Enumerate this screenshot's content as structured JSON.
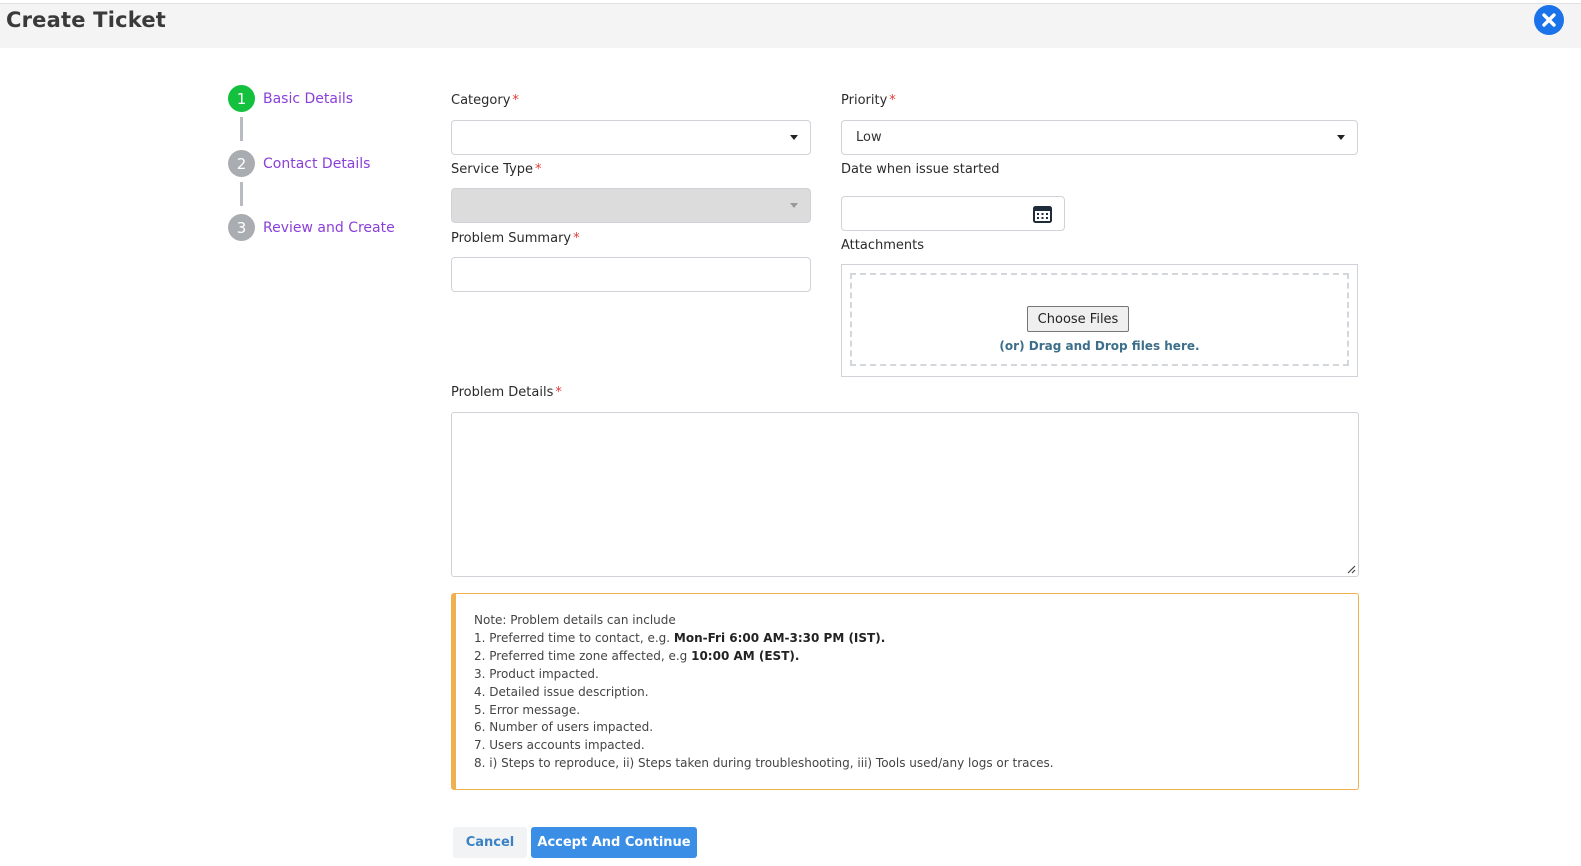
{
  "header": {
    "title": "Create Ticket"
  },
  "steps": [
    {
      "number": "1",
      "label": "Basic Details",
      "state": "active"
    },
    {
      "number": "2",
      "label": "Contact Details",
      "state": "pending"
    },
    {
      "number": "3",
      "label": "Review and Create",
      "state": "pending"
    }
  ],
  "form": {
    "category": {
      "label": "Category",
      "value": ""
    },
    "priority": {
      "label": "Priority",
      "value": "Low"
    },
    "service_type": {
      "label": "Service Type",
      "value": ""
    },
    "date_started": {
      "label": "Date when issue started",
      "value": ""
    },
    "problem_summary": {
      "label": "Problem Summary",
      "value": ""
    },
    "attachments": {
      "label": "Attachments",
      "choose_label": "Choose Files",
      "drop_prefix": "(or)",
      "drop_text": "Drag and Drop files here."
    },
    "problem_details": {
      "label": "Problem Details",
      "value": ""
    },
    "required_marker": "*"
  },
  "note": {
    "intro": "Note: Problem details can include",
    "items": [
      {
        "text": "1. Preferred time to contact, e.g. ",
        "bold": "Mon-Fri 6:00 AM-3:30 PM (IST)."
      },
      {
        "text": "2. Preferred time zone affected, e.g ",
        "bold": "10:00 AM (EST)."
      },
      {
        "text": "3. Product impacted.",
        "bold": ""
      },
      {
        "text": "4. Detailed issue description.",
        "bold": ""
      },
      {
        "text": "5. Error message.",
        "bold": ""
      },
      {
        "text": "6. Number of users impacted.",
        "bold": ""
      },
      {
        "text": "7. Users accounts impacted.",
        "bold": ""
      },
      {
        "text": "8. i) Steps to reproduce, ii) Steps taken during troubleshooting, iii) Tools used/any logs or traces.",
        "bold": ""
      }
    ]
  },
  "actions": {
    "cancel_label": "Cancel",
    "accept_label": "Accept And Continue"
  },
  "colors": {
    "accent": "#3a8ee6",
    "step_active": "#13c13f",
    "step_idle": "#a9adb2",
    "step_label": "#8b3fd9",
    "note_border": "#f0b04f",
    "required": "#e53935"
  },
  "icons": {
    "close": "close-circle-icon",
    "calendar": "calendar-icon",
    "dropdown": "caret-down-icon"
  }
}
